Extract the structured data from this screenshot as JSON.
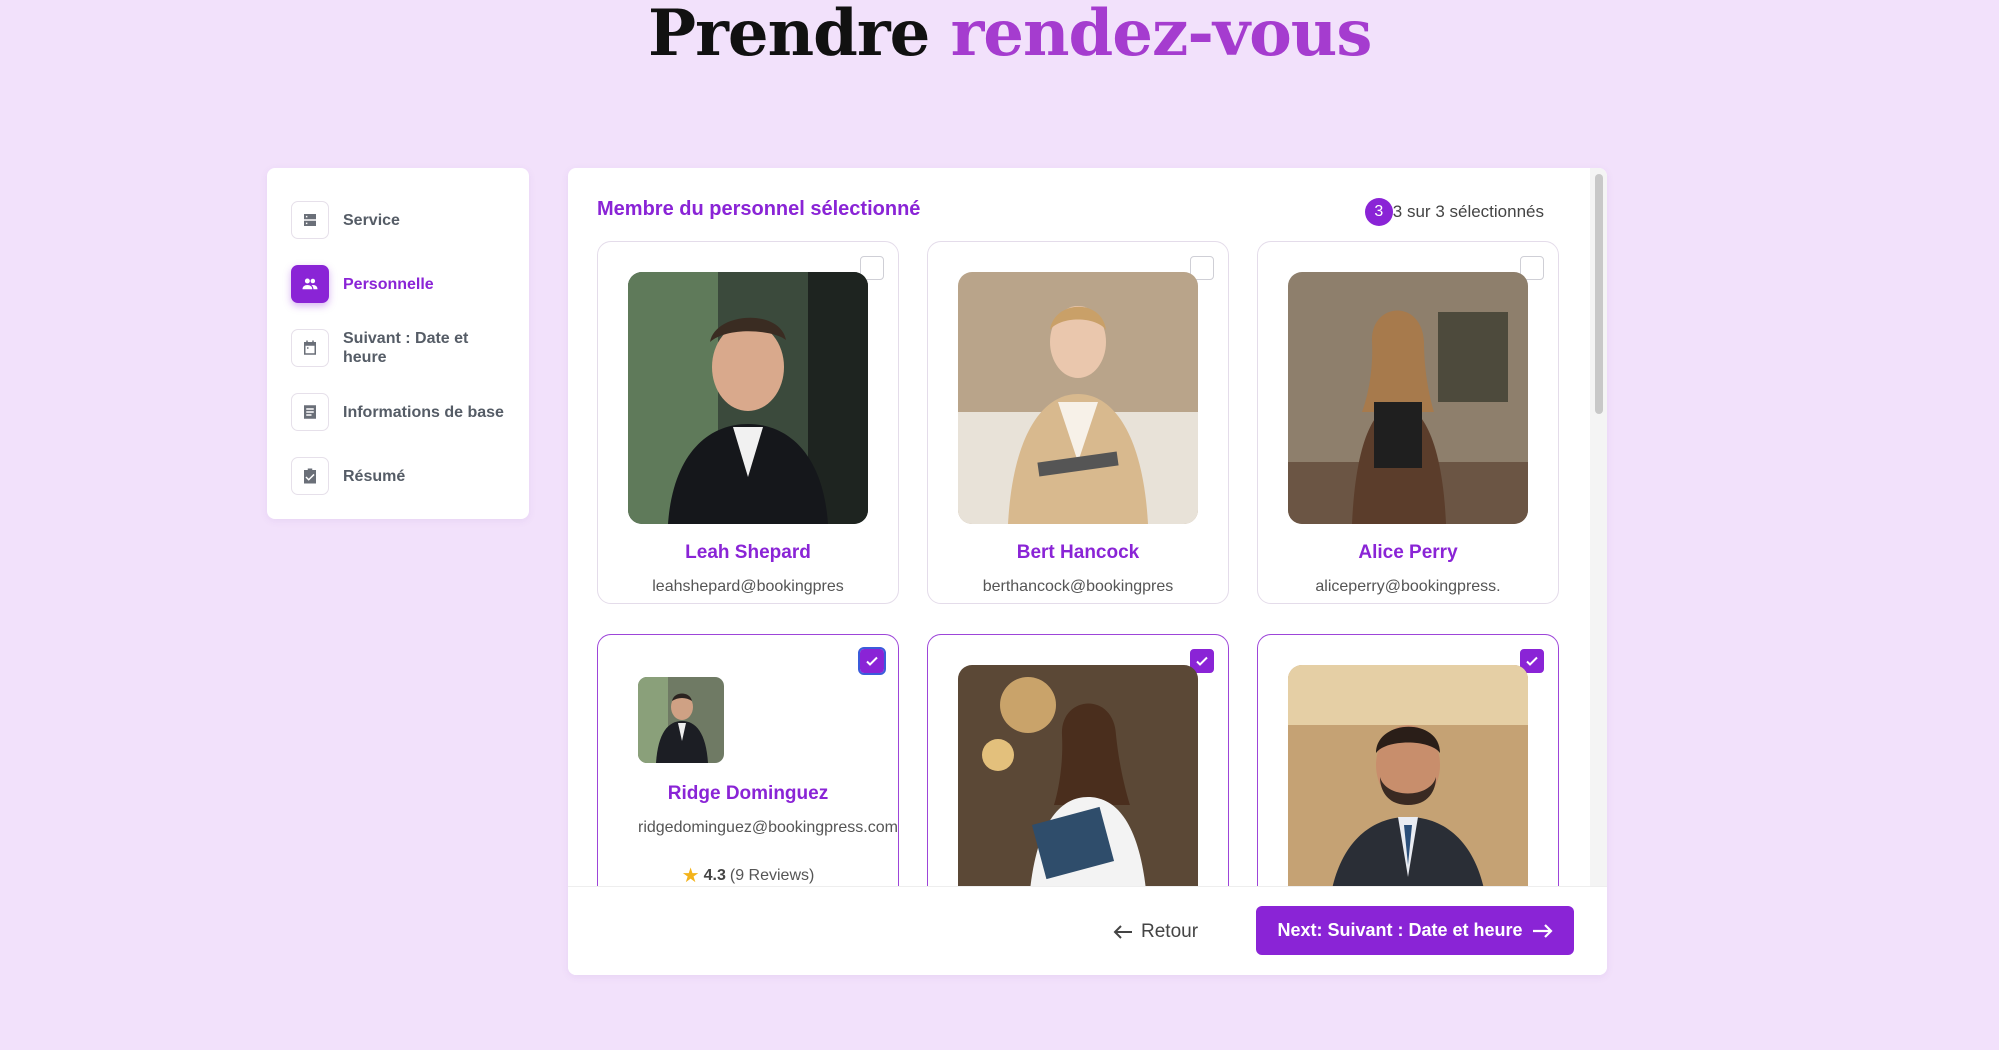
{
  "header": {
    "title_part1": "Prendre",
    "title_part2": "rendez-vous"
  },
  "sidebar": {
    "items": [
      {
        "label": "Service",
        "icon": "server-icon",
        "active": false
      },
      {
        "label": "Personnelle",
        "icon": "people-icon",
        "active": true
      },
      {
        "label": "Suivant : Date et heure",
        "icon": "calendar-icon",
        "active": false
      },
      {
        "label": "Informations de base",
        "icon": "document-icon",
        "active": false
      },
      {
        "label": "Résumé",
        "icon": "clipboard-check-icon",
        "active": false
      }
    ]
  },
  "main": {
    "heading": "Membre du personnel sélectionné",
    "count_badge": "3",
    "count_text": "3 sur 3 sélectionnés",
    "staff": [
      {
        "name": "Leah Shepard",
        "email": "leahshepard@bookingpres",
        "selected": false
      },
      {
        "name": "Bert Hancock",
        "email": "berthancock@bookingpres",
        "selected": false
      },
      {
        "name": "Alice Perry",
        "email": "aliceperry@bookingpress.",
        "selected": false
      },
      {
        "name": "Ridge Dominguez",
        "email": "ridgedominguez@bookingpress.com",
        "selected": true,
        "rating": "4.3",
        "reviews": "(9 Reviews)"
      },
      {
        "name": "",
        "email": "",
        "selected": true
      },
      {
        "name": "",
        "email": "",
        "selected": true
      }
    ]
  },
  "footer": {
    "back_label": "Retour",
    "next_label": "Next: Suivant : Date et heure"
  },
  "colors": {
    "accent": "#8a24d6",
    "background": "#f2e1fb",
    "title_accent": "#a53ccf",
    "star": "#f3b31b"
  }
}
